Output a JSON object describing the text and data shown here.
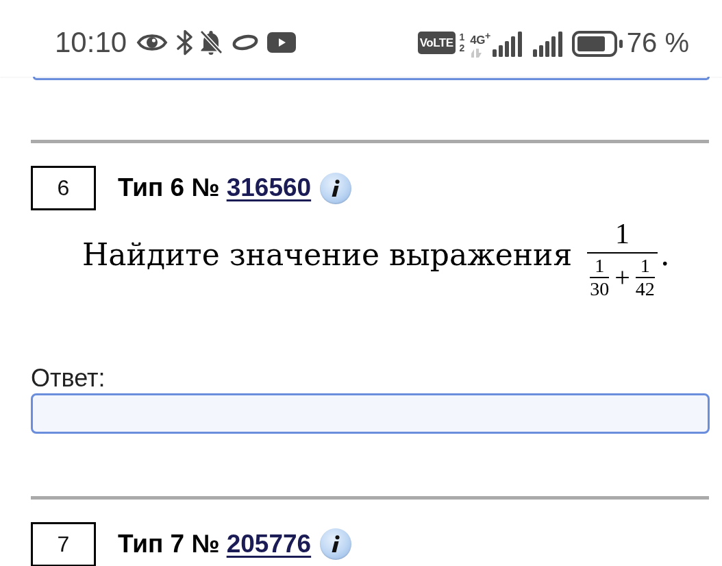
{
  "status_bar": {
    "time": "10:10",
    "volte_badge": "VoLTE",
    "sim_labels": [
      "1",
      "2"
    ],
    "network_type": "4G$^{+}$",
    "battery_percent": "76 %"
  },
  "questions": [
    {
      "number": "6",
      "type_label": "Тип 6 №",
      "problem_id": "316560",
      "problem": {
        "text": "Найдите значение выражения",
        "fraction": {
          "numerator": "1",
          "denominator": {
            "terms": [
              {
                "numerator": "1",
                "denominator": "30"
              },
              {
                "numerator": "1",
                "denominator": "42"
              }
            ],
            "operator": "+"
          }
        },
        "end_mark": "."
      },
      "answer_label": "Ответ:"
    },
    {
      "number": "7",
      "type_label": "Тип 7 №",
      "problem_id": "205776"
    }
  ]
}
